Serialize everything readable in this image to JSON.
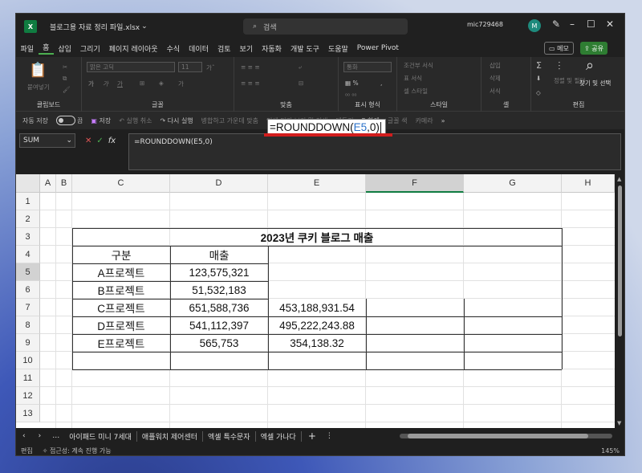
{
  "app": {
    "file_name": "블로그용 자료 정리 파일.xlsx",
    "dropdown_glyph": "⌄",
    "search_placeholder": "검색",
    "user_id": "mic729468",
    "avatar_letter": "M",
    "excel_badge": "X"
  },
  "menu": [
    "파일",
    "홈",
    "삽입",
    "그리기",
    "페이지 레이아웃",
    "수식",
    "데이터",
    "검토",
    "보기",
    "자동화",
    "개발 도구",
    "도움말",
    "Power Pivot"
  ],
  "memo_label": "메모",
  "share_label": "공유",
  "ribbon": {
    "groups": [
      "클립보드",
      "글꼴",
      "맞춤",
      "표시 형식",
      "스타일",
      "셀",
      "편집"
    ],
    "paste_label": "붙여넣기",
    "font_name": "맑은 고딕",
    "font_size": "11",
    "number_format": "통화",
    "cond_format": "조건부 서식",
    "table_format": "표 서식",
    "cell_style": "셀 스타일",
    "insert": "삽입",
    "delete": "삭제",
    "format": "서식",
    "sort_filter": "정렬 및 필터",
    "find_select": "찾기 및 선택"
  },
  "quick": {
    "autosave": "자동 저장",
    "autosave_state": "끔",
    "save": "저장",
    "undo": "실행 취소",
    "redo": "다시 실행",
    "merge": "병합하고 가운데 맞춤",
    "print": "인쇄 미리 보기 및 인쇄",
    "border": "테두리",
    "sum": "합계",
    "fill_color": "글꼴 색",
    "camera": "카메라",
    "more": "»"
  },
  "formula_bar": {
    "name_box": "SUM",
    "formula": "=ROUNDDOWN(E5,0)"
  },
  "columns": [
    "A",
    "B",
    "C",
    "D",
    "E",
    "F",
    "G",
    "H"
  ],
  "rows": [
    "1",
    "2",
    "3",
    "4",
    "5",
    "6",
    "7",
    "8",
    "9",
    "10",
    "11",
    "12",
    "13"
  ],
  "table": {
    "title": "2023년 쿠키 블로그 매출",
    "header_c": "구분",
    "header_d": "매출",
    "rows": [
      {
        "c": "A프로젝트",
        "d": "123,575,321",
        "e": ""
      },
      {
        "c": "B프로젝트",
        "d": "51,532,183",
        "e": ""
      },
      {
        "c": "C프로젝트",
        "d": "651,588,736",
        "e": "453,188,931.54"
      },
      {
        "c": "D프로젝트",
        "d": "541,112,397",
        "e": "495,222,243.88"
      },
      {
        "c": "E프로젝트",
        "d": "565,753",
        "e": "354,138.32"
      }
    ]
  },
  "edit": {
    "prefix": "=ROUNDDOWN(",
    "ref": "E5",
    "suffix": ",0)"
  },
  "sheet_tabs": [
    "아이패드 미니 7세대",
    "애플워치 제어센터",
    "엑셀 특수문자",
    "엑셀 가나다"
  ],
  "add_sheet": "+",
  "status": {
    "mode": "편집",
    "accessibility": "접근성: 계속 진행 가능",
    "zoom": "145%"
  },
  "colors": {
    "excel_green": "#107c41",
    "accent_red": "#d21d1d",
    "ref_blue": "#2b72c9"
  }
}
